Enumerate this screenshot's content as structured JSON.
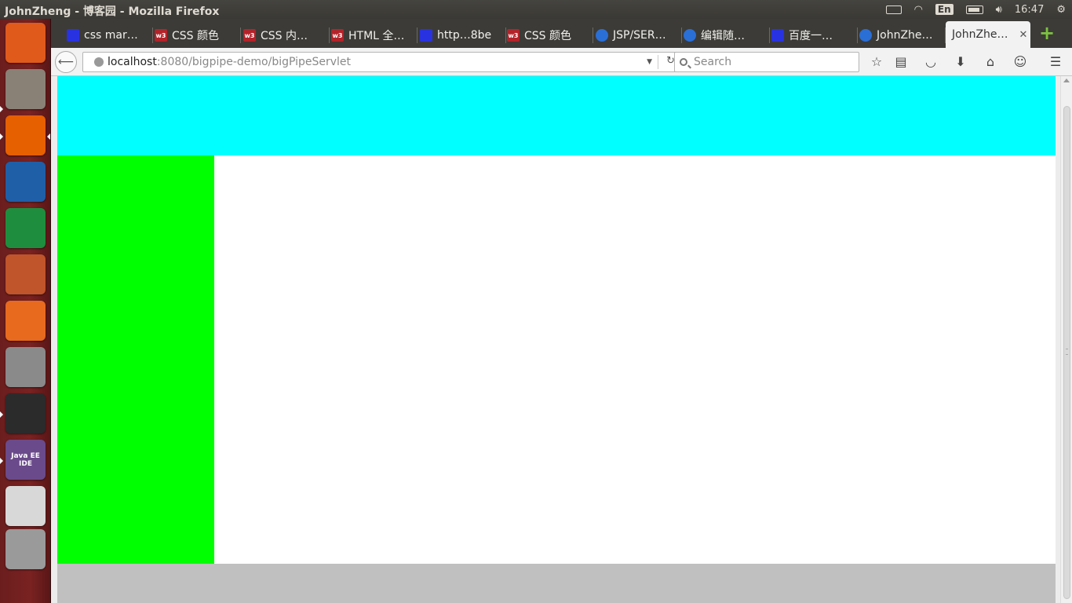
{
  "window": {
    "title": "JohnZheng - 博客园 - Mozilla Firefox"
  },
  "tray": {
    "input_method": "En",
    "clock": "16:47"
  },
  "launcher": {
    "items": [
      {
        "name": "ubuntu-dash",
        "color": "#e05a1c"
      },
      {
        "name": "files",
        "color": "#8a8176"
      },
      {
        "name": "firefox",
        "color": "#e66000"
      },
      {
        "name": "libreoffice-writer",
        "color": "#1f5fa8"
      },
      {
        "name": "libreoffice-calc",
        "color": "#1e8e3e"
      },
      {
        "name": "libreoffice-impress",
        "color": "#c0542a"
      },
      {
        "name": "software-center",
        "color": "#e86a1f"
      },
      {
        "name": "system-settings",
        "color": "#8a8a8a"
      },
      {
        "name": "terminal",
        "color": "#2b2b2b"
      },
      {
        "name": "java-ee-ide",
        "color": "#6a4a8a"
      },
      {
        "name": "text-editor",
        "color": "#d8d8d8"
      },
      {
        "name": "trash",
        "color": "#9a9a9a"
      }
    ],
    "java_ide_label": "Java EE IDE"
  },
  "tabs": [
    {
      "label": "css mar…",
      "favicon": "baidu"
    },
    {
      "label": "CSS 颜色",
      "favicon": "w3"
    },
    {
      "label": "CSS 内…",
      "favicon": "w3"
    },
    {
      "label": "HTML 全…",
      "favicon": "w3"
    },
    {
      "label": "http…8be",
      "favicon": "baidu"
    },
    {
      "label": "CSS 颜色",
      "favicon": "w3"
    },
    {
      "label": "JSP/SER…",
      "favicon": "cnblogs"
    },
    {
      "label": "编辑随…",
      "favicon": "cnblogs"
    },
    {
      "label": "百度一…",
      "favicon": "baidu"
    },
    {
      "label": "JohnZhe…",
      "favicon": "cnblogs"
    }
  ],
  "active_tab": {
    "label": "JohnZhe…",
    "close": "✕"
  },
  "favicon_labels": {
    "w3": "w3"
  },
  "urlbar": {
    "host": "localhost",
    "rest": ":8080/bigpipe-demo/bigPipeServlet"
  },
  "searchbar": {
    "placeholder": "Search"
  },
  "page": {
    "header_color": "#00ffff",
    "sidebar_color": "#00ff00",
    "main_color": "#ffffff",
    "footer_color": "#c0c0c0"
  }
}
